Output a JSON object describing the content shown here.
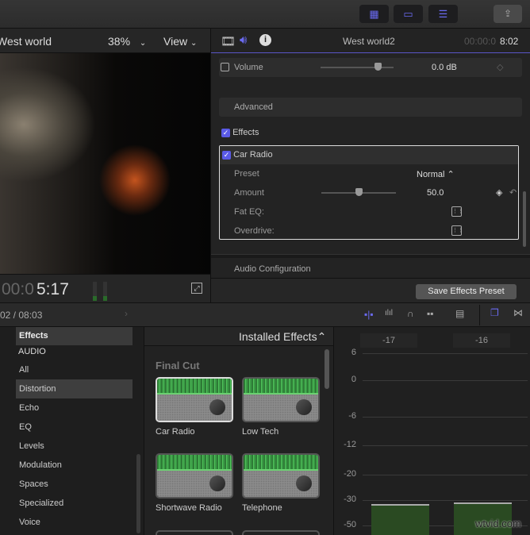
{
  "toolbar": {
    "buttons": [
      "browser-view-icon",
      "timeline-view-icon",
      "inspector-icon"
    ],
    "share": "share-icon"
  },
  "viewer": {
    "title": "West world",
    "zoom": "38%",
    "view": "View",
    "timecode_dim": "00:0",
    "timecode": "5:17"
  },
  "inspector": {
    "title": "West world2",
    "timecode_dim": "00:00:0",
    "timecode": "8:02",
    "volume_label": "Volume",
    "volume_value": "0.0 dB",
    "volume_level": 0.8,
    "advanced": "Advanced",
    "effects_label": "Effects",
    "effect": {
      "name": "Car Radio",
      "preset_label": "Preset",
      "preset_value": "Normal",
      "amount_label": "Amount",
      "amount_value": "50.0",
      "amount_level": 0.5,
      "fat_eq": "Fat EQ:",
      "overdrive": "Overdrive:"
    },
    "audio_config": "Audio Configuration",
    "save_button": "Save Effects Preset"
  },
  "timeline": {
    "position": "02 / 08:03"
  },
  "browser": {
    "header": "Effects",
    "section": "AUDIO",
    "items": [
      "All",
      "Distortion",
      "Echo",
      "EQ",
      "Levels",
      "Modulation",
      "Spaces",
      "Specialized",
      "Voice"
    ],
    "selected": "Distortion",
    "dropdown": "Installed Effects",
    "group": "Final Cut",
    "effects": [
      "Car Radio",
      "Low Tech",
      "Shortwave Radio",
      "Telephone"
    ]
  },
  "meters": {
    "peaks": [
      "-17",
      "-16"
    ],
    "scale": [
      "6",
      "0",
      "-6",
      "-12",
      "-20",
      "-30",
      "-50"
    ],
    "levels_db": [
      -33,
      -32
    ]
  },
  "watermark": "wtvid.com",
  "colors": {
    "accent": "#5a5ae6",
    "meter": "#2a4a22"
  }
}
